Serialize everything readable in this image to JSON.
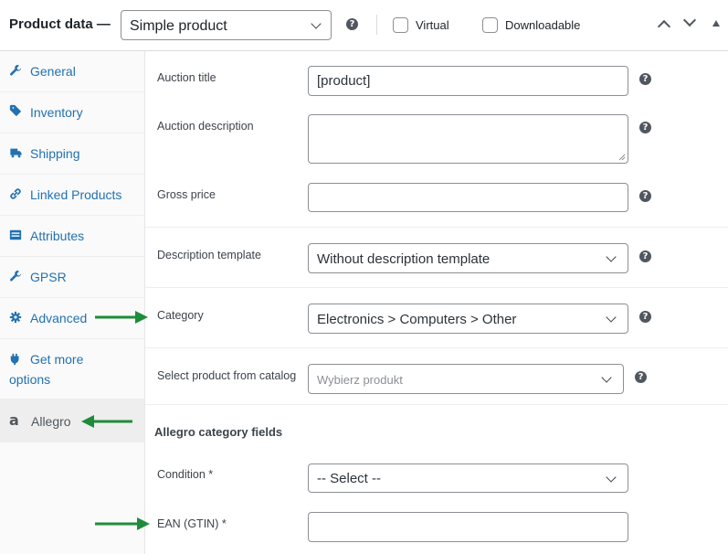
{
  "header": {
    "title": "Product data —",
    "product_type": "Simple product",
    "virtual_label": "Virtual",
    "downloadable_label": "Downloadable"
  },
  "sidebar": {
    "items": [
      {
        "label": "General",
        "icon": "wrench-icon"
      },
      {
        "label": "Inventory",
        "icon": "tag-icon"
      },
      {
        "label": "Shipping",
        "icon": "truck-icon"
      },
      {
        "label": "Linked Products",
        "icon": "link-icon"
      },
      {
        "label": "Attributes",
        "icon": "list-icon"
      },
      {
        "label": "GPSR",
        "icon": "wrench-icon"
      },
      {
        "label": "Advanced",
        "icon": "gear-icon"
      },
      {
        "label": "Get more",
        "label2": "options",
        "icon": "plug-icon"
      },
      {
        "label": "Allegro",
        "icon": "allegro-icon",
        "icon_glyph": "a",
        "active": true
      }
    ]
  },
  "form": {
    "auction_title": {
      "label": "Auction title",
      "value": "[product]"
    },
    "auction_description": {
      "label": "Auction description",
      "value": ""
    },
    "gross_price": {
      "label": "Gross price",
      "value": ""
    },
    "description_template": {
      "label": "Description template",
      "value": "Without description template"
    },
    "category": {
      "label": "Category",
      "value": "Electronics > Computers > Other"
    },
    "catalog": {
      "label": "Select product from catalog",
      "placeholder": "Wybierz produkt"
    },
    "section_title": "Allegro category fields",
    "condition": {
      "label": "Condition *",
      "value": "-- Select --"
    },
    "ean": {
      "label": "EAN (GTIN) *",
      "value": ""
    }
  },
  "help_glyph": "?",
  "colors": {
    "link": "#2271b1",
    "arrow": "#1e8c3a",
    "border": "#8c8f94"
  }
}
